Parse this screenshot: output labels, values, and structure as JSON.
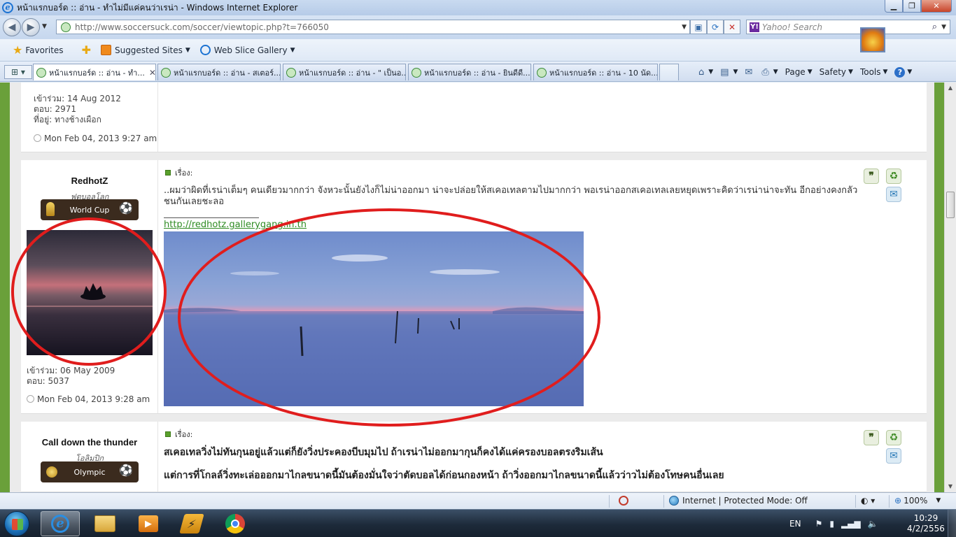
{
  "window": {
    "title": "หน้าแรกบอร์ด :: อ่าน - ทำไม่มีแค่คนว่าเรน่า - Windows Internet Explorer",
    "min_glyph": "▁",
    "max_glyph": "❐",
    "close_glyph": "✕"
  },
  "address_bar": {
    "url": "http://www.soccersuck.com/soccer/viewtopic.php?t=766050",
    "search_placeholder": "Yahoo! Search",
    "search_logo": "Y!"
  },
  "favorites_bar": {
    "favorites_label": "Favorites",
    "suggested_sites": "Suggested Sites",
    "web_slice_gallery": "Web Slice Gallery"
  },
  "tabs": [
    {
      "label": "หน้าแรกบอร์ด :: อ่าน - ทำ...",
      "active": true
    },
    {
      "label": "หน้าแรกบอร์ด :: อ่าน - สเตอร์...",
      "active": false
    },
    {
      "label": "หน้าแรกบอร์ด :: อ่าน - \" เป็นอ...",
      "active": false
    },
    {
      "label": "หน้าแรกบอร์ด :: อ่าน - ยินดีดี...",
      "active": false
    },
    {
      "label": "หน้าแรกบอร์ด :: อ่าน - 10 นัด...",
      "active": false
    }
  ],
  "command_bar": {
    "page": "Page",
    "safety": "Safety",
    "tools": "Tools",
    "help": "?"
  },
  "posts": [
    {
      "joined": "เข้าร่วม: 14 Aug 2012",
      "replies": "ตอบ: 2971",
      "location": "ที่อยู่: ทางช้างเผือก",
      "time": "Mon Feb 04, 2013 9:27 am"
    },
    {
      "username": "RedhotZ",
      "rank": "ฟุตบอลโลก",
      "badge": "World Cup",
      "joined": "เข้าร่วม: 06 May 2009",
      "replies": "ตอบ: 5037",
      "time": "Mon Feb 04, 2013 9:28 am",
      "subject_label": "เรื่อง:",
      "text": "..ผมว่าผิดที่เรน่าเต็มๆ คนเดียวมากกว่า จังหวะนั้นยังไงก็ไม่น่าออกมา น่าจะปล่อยให้สเคอเทลตามไปมากกว่า พอเรน่าออกสเคอเทลเลยหยุดเพราะคิดว่าเรน่าน่าจะทัน อีกอย่างคงกลัวชนกันเลยชะลอ",
      "signature_link": "http://redhotz.gallerygang.in.th"
    },
    {
      "username": "Call down the thunder",
      "rank": "โอลิมปิก",
      "badge": "Olympic",
      "subject_label": "เรื่อง:",
      "line1": "สเคอเทลวิ่งไม่ทันกุนอยู่แล้วแต่ก็ยังวิ่งประคองบีบมุมไป ถ้าเรน่าไม่ออกมากุนก็คงได้แค่ครองบอลตรงริมเส้น",
      "line2": "แต่การที่โกลล์วิ่งทะเล่อออกมาไกลขนาดนี้มันต้องมั่นใจว่าตัดบอลได้ก่อนกองหน้า ถ้าวิ่งออกมาไกลขนาดนี้แล้วว่าวไม่ต้องโทษคนอื่นเลย"
    }
  ],
  "post_actions": {
    "quote": "❞",
    "share": "♻",
    "pm": "✉"
  },
  "status_bar": {
    "zone": "Internet | Protected Mode: Off",
    "zoom": "100%"
  },
  "taskbar": {
    "language": "EN",
    "time": "10:29",
    "date": "4/2/2556"
  }
}
